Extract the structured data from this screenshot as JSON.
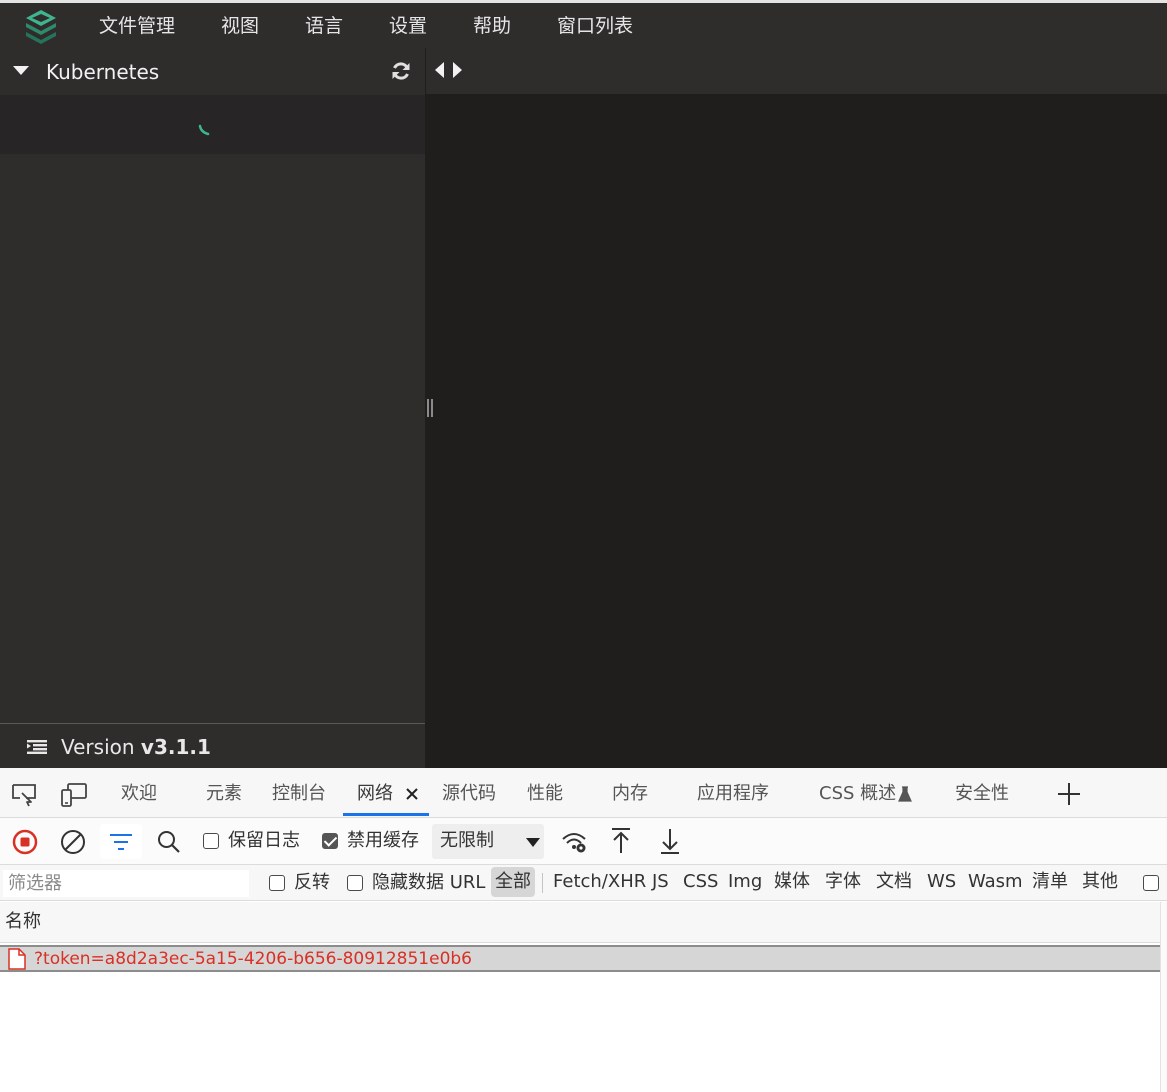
{
  "menubar": {
    "items": [
      "文件管理",
      "视图",
      "语言",
      "设置",
      "帮助",
      "窗口列表"
    ]
  },
  "sidebar": {
    "title": "Kubernetes",
    "footer": {
      "version_label": "Version",
      "version_number": "v3.1.1"
    }
  },
  "devtools": {
    "tabs": [
      "欢迎",
      "元素",
      "控制台",
      "网络",
      "源代码",
      "性能",
      "内存",
      "应用程序",
      "CSS 概述",
      "安全性"
    ],
    "active_tab": "网络",
    "toolbar": {
      "preserve_log": {
        "label": "保留日志",
        "checked": false
      },
      "disable_cache": {
        "label": "禁用缓存",
        "checked": true
      },
      "throttling": "无限制"
    },
    "filterbar": {
      "placeholder": "筛选器",
      "invert": {
        "label": "反转",
        "checked": false
      },
      "hide_data_urls": {
        "label": "隐藏数据 URL",
        "checked": false
      },
      "types": [
        "全部",
        "Fetch/XHR",
        "JS",
        "CSS",
        "Img",
        "媒体",
        "字体",
        "文档",
        "WS",
        "Wasm",
        "清单",
        "其他"
      ],
      "active_type": "全部"
    },
    "table": {
      "columns": [
        "名称"
      ],
      "rows": [
        {
          "name": "?token=a8d2a3ec-5a15-4206-b656-80912851e0b6"
        }
      ]
    }
  },
  "colors": {
    "app_bg": "#1f1e1d",
    "sidebar_bg": "#2f2c2c",
    "accent_teal": "#3fb58f",
    "link_blue": "#1a73e8",
    "error_red": "#d93025"
  }
}
